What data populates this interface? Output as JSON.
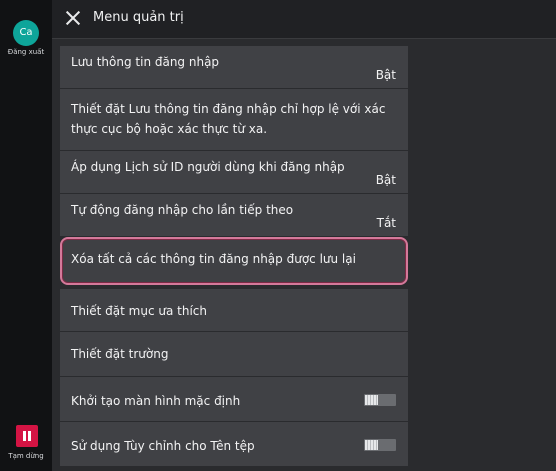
{
  "sidebar": {
    "avatar_initials": "Ca",
    "signout_label": "Đăng xuất",
    "pause_label": "Tạm dừng"
  },
  "header": {
    "title": "Menu quản trị"
  },
  "settings": [
    {
      "label": "Lưu thông tin đăng nhập",
      "value": "Bật"
    },
    {
      "label": "Thiết đặt Lưu thông tin đăng nhập chỉ hợp lệ với xác thực cục bộ hoặc xác thực từ xa."
    },
    {
      "label": "Áp dụng Lịch sử ID người dùng khi đăng nhập",
      "value": "Bật"
    },
    {
      "label": "Tự động đăng nhập cho lần tiếp theo",
      "value": "Tắt"
    },
    {
      "label": "Xóa tất cả các thông tin đăng nhập được lưu lại"
    },
    {
      "label": "Thiết đặt mục ưa thích"
    },
    {
      "label": "Thiết đặt trường"
    },
    {
      "label": "Khởi tạo màn hình mặc định",
      "toggle": "off"
    },
    {
      "label": "Sử dụng Tùy chỉnh cho Tên tệp",
      "toggle": "off"
    }
  ],
  "colors": {
    "highlight_border": "#d4799a",
    "pause_button": "#d41444",
    "avatar": "#0ea59a"
  }
}
